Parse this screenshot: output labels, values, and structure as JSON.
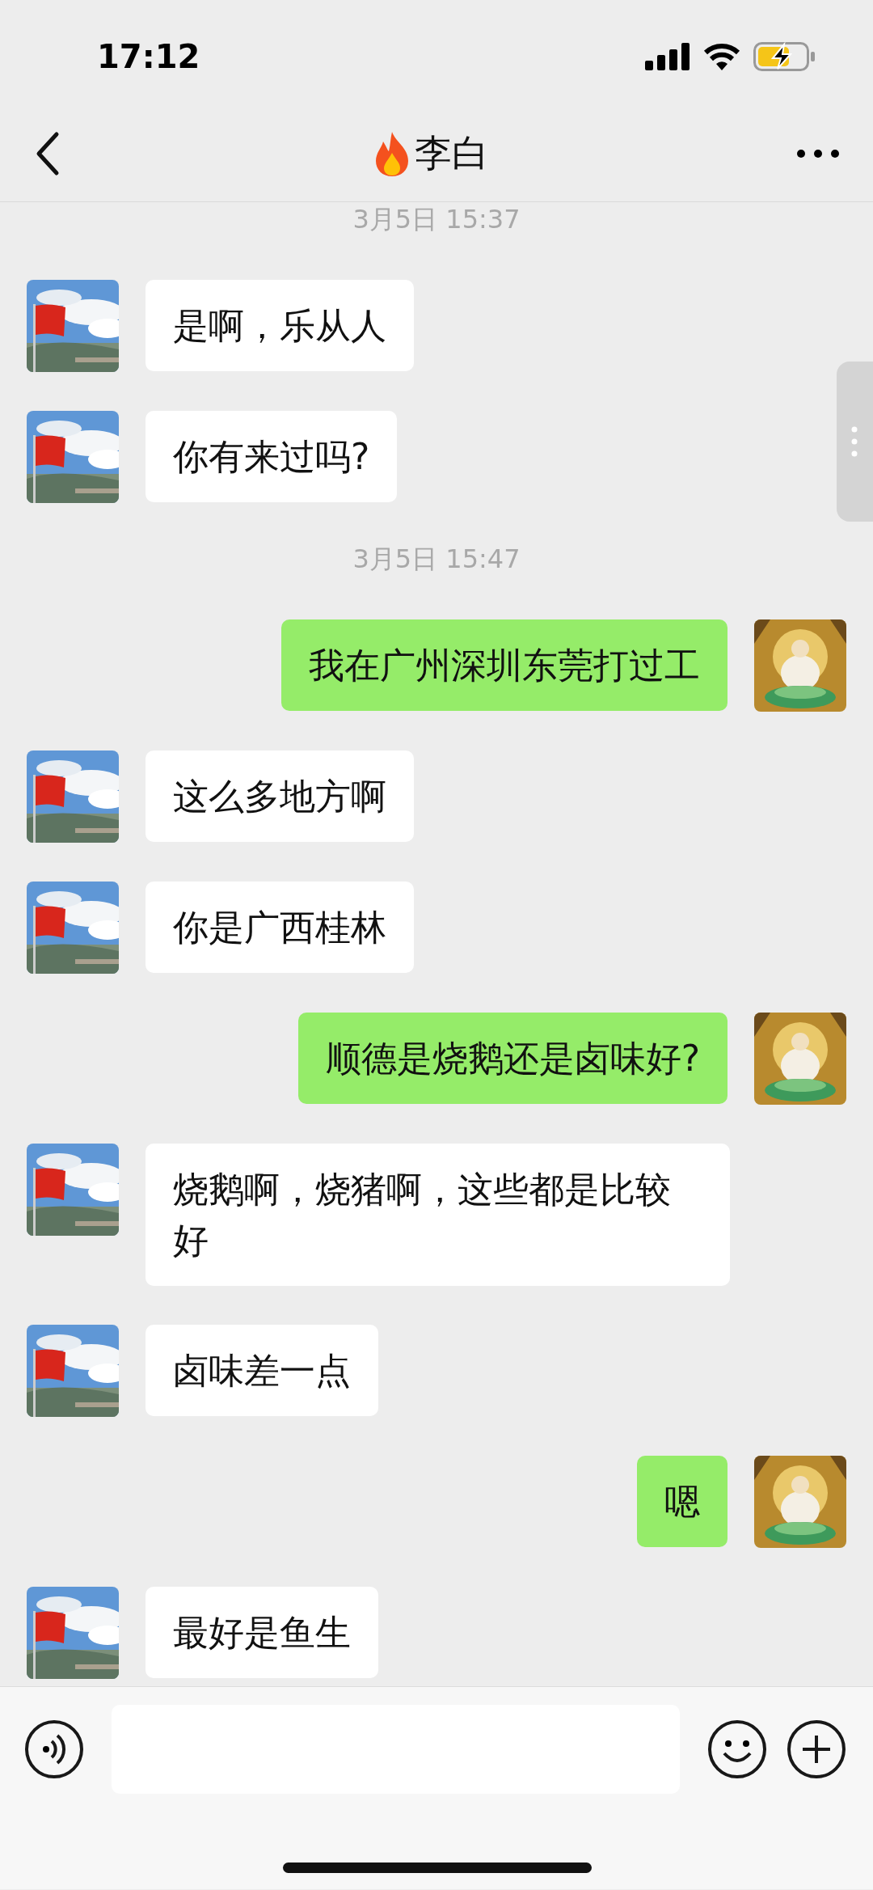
{
  "status_bar": {
    "time": "17:12"
  },
  "header": {
    "title": "李白"
  },
  "messages": [
    {
      "kind": "time",
      "text": "3月5日 15:37"
    },
    {
      "kind": "received",
      "text": "是啊，乐从人"
    },
    {
      "kind": "received",
      "text": "你有来过吗?"
    },
    {
      "kind": "time",
      "text": "3月5日 15:47"
    },
    {
      "kind": "sent",
      "text": "我在广州深圳东莞打过工"
    },
    {
      "kind": "received",
      "text": "这么多地方啊"
    },
    {
      "kind": "received",
      "text": "你是广西桂林"
    },
    {
      "kind": "sent",
      "text": "顺德是烧鹅还是卤味好?"
    },
    {
      "kind": "received",
      "text": "烧鹅啊，烧猪啊，这些都是比较好"
    },
    {
      "kind": "received",
      "text": "卤味差一点"
    },
    {
      "kind": "sent",
      "text": "嗯"
    },
    {
      "kind": "received",
      "text": "最好是鱼生"
    }
  ]
}
